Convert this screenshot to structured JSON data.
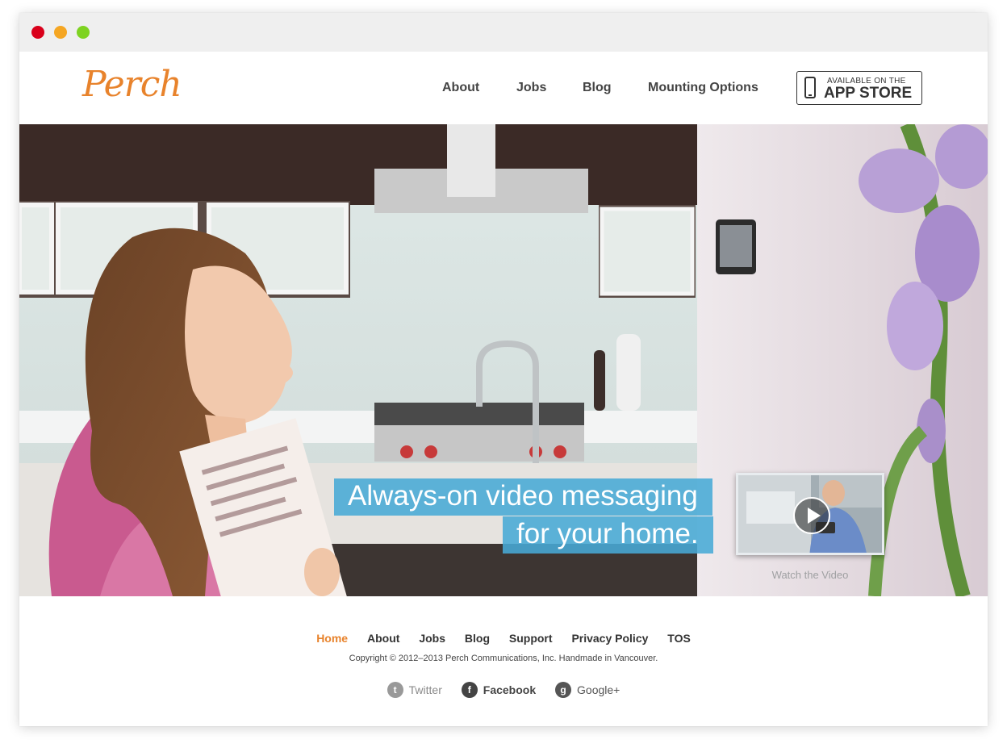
{
  "browser": {
    "controls": [
      "close",
      "minimize",
      "maximize"
    ]
  },
  "header": {
    "logo": "Perch",
    "nav": [
      {
        "label": "About"
      },
      {
        "label": "Jobs"
      },
      {
        "label": "Blog"
      },
      {
        "label": "Mounting Options"
      }
    ],
    "app_store": {
      "line1": "AVAILABLE ON THE",
      "line2": "APP STORE",
      "icon": "phone-icon"
    }
  },
  "hero": {
    "headline_line1": "Always-on video messaging",
    "headline_line2": "for your home.",
    "watch_video_label": "Watch the Video",
    "play_icon": "play-icon",
    "headline_bg_color": "#48AAD6"
  },
  "footer": {
    "nav": [
      {
        "label": "Home",
        "active": true
      },
      {
        "label": "About"
      },
      {
        "label": "Jobs"
      },
      {
        "label": "Blog"
      },
      {
        "label": "Support"
      },
      {
        "label": "Privacy Policy"
      },
      {
        "label": "TOS"
      }
    ],
    "copyright": "Copyright © 2012–2013 Perch Communications, Inc. Handmade in Vancouver.",
    "social": [
      {
        "label": "Twitter",
        "icon": "twitter-icon"
      },
      {
        "label": "Facebook",
        "icon": "facebook-icon"
      },
      {
        "label": "Google+",
        "icon": "google-plus-icon"
      }
    ]
  },
  "colors": {
    "brand_orange": "#E8832C",
    "text_dark": "#444444"
  }
}
